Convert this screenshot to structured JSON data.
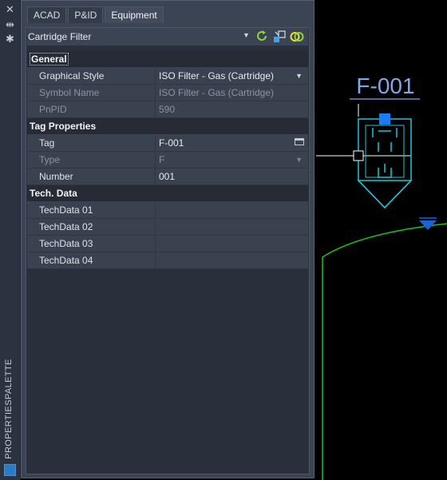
{
  "strip": {
    "icons": [
      "close-icon",
      "auto-hide-icon",
      "settings-icon"
    ],
    "vertical_label": "PROPERTIESPALETTE"
  },
  "tabs": [
    {
      "label": "ACAD",
      "active": false
    },
    {
      "label": "P&ID",
      "active": false
    },
    {
      "label": "Equipment",
      "active": true
    }
  ],
  "selector": {
    "value": "Cartridge Filter",
    "tools": [
      "refresh-icon",
      "select-objects-icon",
      "quick-select-icon"
    ]
  },
  "sections": [
    {
      "title": "General",
      "rows": [
        {
          "key": "Graphical Style",
          "value": "ISO Filter - Gas (Cartridge)",
          "disabled": false,
          "control": "dropdown"
        },
        {
          "key": "Symbol Name",
          "value": "ISO Filter - Gas (Cartridge)",
          "disabled": true,
          "control": "none"
        },
        {
          "key": "PnPID",
          "value": "590",
          "disabled": true,
          "control": "none"
        }
      ]
    },
    {
      "title": "Tag Properties",
      "rows": [
        {
          "key": "Tag",
          "value": "F-001",
          "disabled": false,
          "control": "picker"
        },
        {
          "key": "Type",
          "value": "F",
          "disabled": true,
          "control": "dropdown"
        },
        {
          "key": "Number",
          "value": "001",
          "disabled": false,
          "control": "none"
        }
      ]
    },
    {
      "title": "Tech. Data",
      "rows": [
        {
          "key": "TechData 01",
          "value": "",
          "disabled": false,
          "control": "none"
        },
        {
          "key": "TechData 02",
          "value": "",
          "disabled": false,
          "control": "none"
        },
        {
          "key": "TechData 03",
          "value": "",
          "disabled": false,
          "control": "none"
        },
        {
          "key": "TechData 04",
          "value": "",
          "disabled": false,
          "control": "none"
        }
      ]
    }
  ],
  "drawing": {
    "tag_label": "F-001",
    "colors": {
      "symbol": "#1fc6d8",
      "grip": "#1a7bff",
      "tag": "#7fa8e6",
      "vessel": "#12c81a",
      "marker": "#1565d8"
    }
  }
}
